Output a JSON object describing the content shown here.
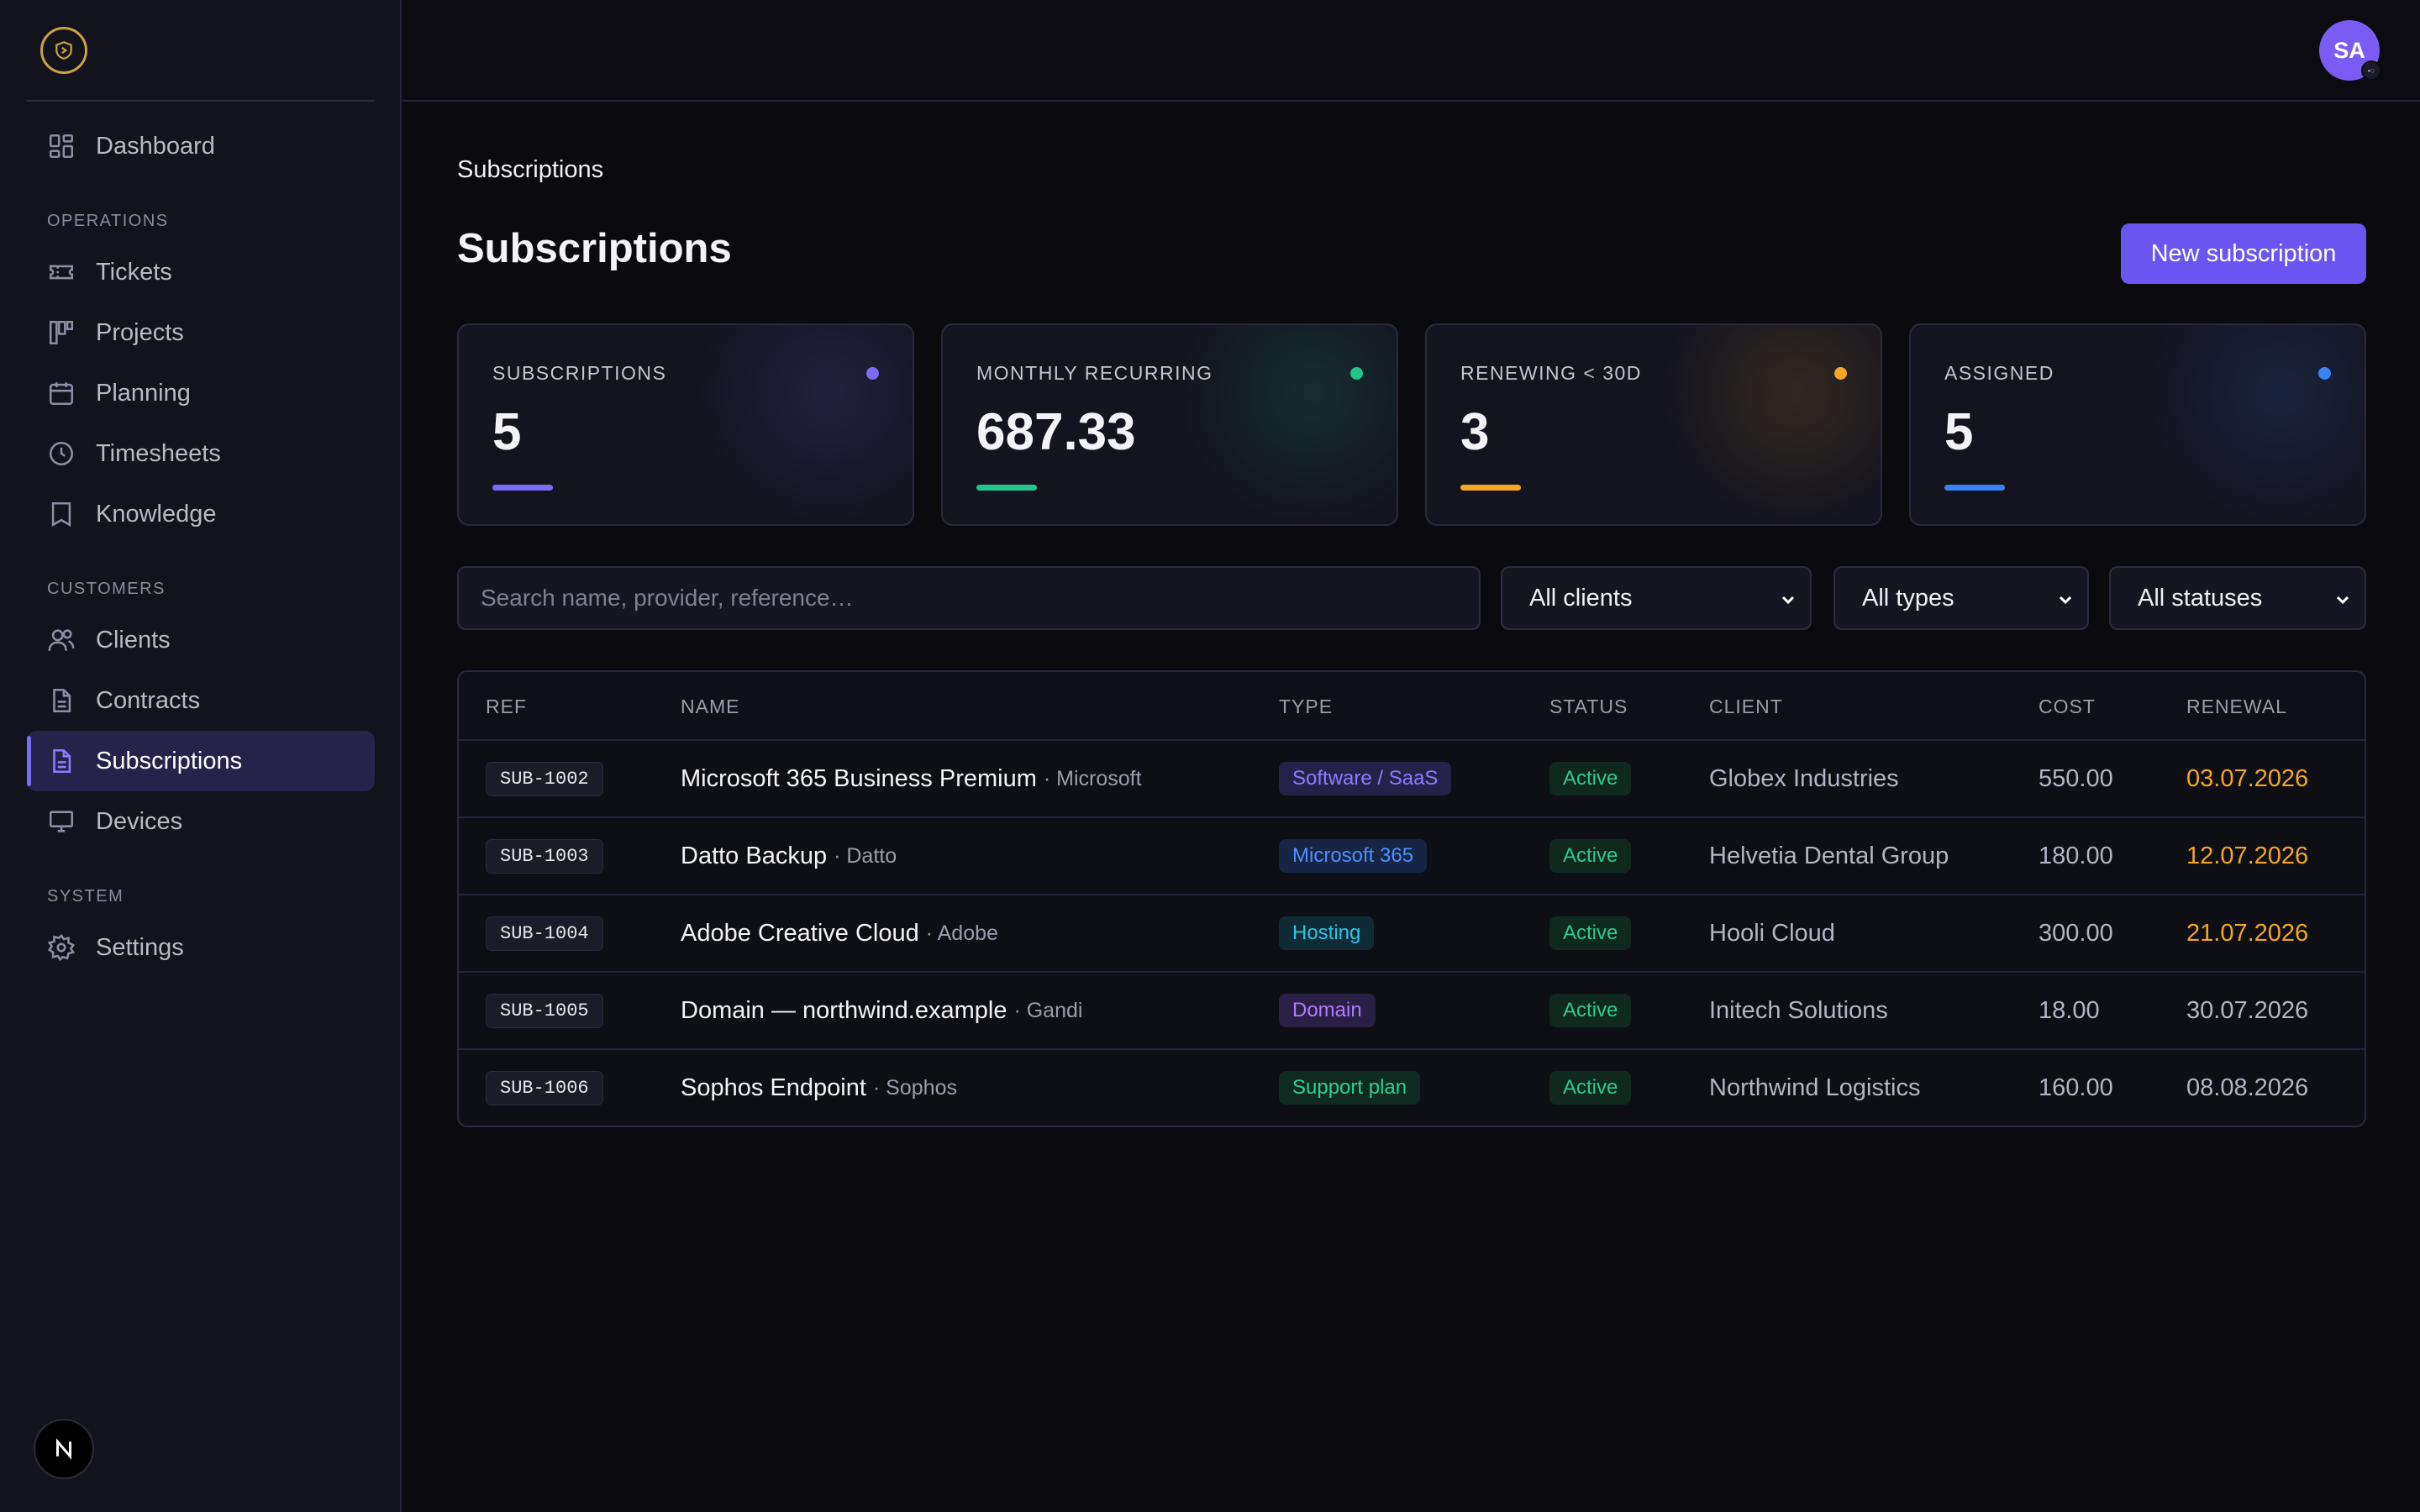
{
  "sidebar": {
    "items": [
      {
        "label": "Dashboard",
        "icon": "dashboard-icon"
      },
      {
        "section": "OPERATIONS"
      },
      {
        "label": "Tickets",
        "icon": "ticket-icon"
      },
      {
        "label": "Projects",
        "icon": "kanban-icon"
      },
      {
        "label": "Planning",
        "icon": "calendar-icon"
      },
      {
        "label": "Timesheets",
        "icon": "clock-icon"
      },
      {
        "label": "Knowledge",
        "icon": "book-icon"
      },
      {
        "section": "CUSTOMERS"
      },
      {
        "label": "Clients",
        "icon": "users-icon"
      },
      {
        "label": "Contracts",
        "icon": "document-icon"
      },
      {
        "label": "Subscriptions",
        "icon": "document-icon",
        "active": true
      },
      {
        "label": "Devices",
        "icon": "monitor-icon"
      },
      {
        "section": "SYSTEM"
      },
      {
        "label": "Settings",
        "icon": "gear-icon"
      }
    ],
    "footer_badge": "N"
  },
  "header": {
    "avatar_initials": "SA"
  },
  "main": {
    "breadcrumb": "Subscriptions",
    "title": "Subscriptions",
    "new_button": "New subscription",
    "stats": [
      {
        "label": "SUBSCRIPTIONS",
        "value": "5",
        "color": "#7b6cf6"
      },
      {
        "label": "MONTHLY RECURRING",
        "value": "687.33",
        "color": "#22c58b"
      },
      {
        "label": "RENEWING < 30D",
        "value": "3",
        "color": "#f5a623"
      },
      {
        "label": "ASSIGNED",
        "value": "5",
        "color": "#3b82f6"
      }
    ],
    "search": {
      "placeholder": "Search name, provider, reference…",
      "value": ""
    },
    "filters": {
      "clients": "All clients",
      "types": "All types",
      "statuses": "All statuses"
    },
    "table": {
      "columns": [
        "REF",
        "NAME",
        "TYPE",
        "STATUS",
        "CLIENT",
        "COST",
        "RENEWAL"
      ],
      "rows": [
        {
          "ref": "SUB-1002",
          "name": "Microsoft 365 Business Premium",
          "provider": "· Microsoft",
          "type": "Software / SaaS",
          "status": "Active",
          "client": "Globex Industries",
          "cost": "550.00",
          "renewal": "03.07.2026",
          "soon": true
        },
        {
          "ref": "SUB-1003",
          "name": "Datto Backup",
          "provider": "· Datto",
          "type": "Microsoft 365",
          "status": "Active",
          "client": "Helvetia Dental Group",
          "cost": "180.00",
          "renewal": "12.07.2026",
          "soon": true
        },
        {
          "ref": "SUB-1004",
          "name": "Adobe Creative Cloud",
          "provider": "· Adobe",
          "type": "Hosting",
          "status": "Active",
          "client": "Hooli Cloud",
          "cost": "300.00",
          "renewal": "21.07.2026",
          "soon": true
        },
        {
          "ref": "SUB-1005",
          "name": "Domain — northwind.example",
          "provider": "· Gandi",
          "type": "Domain",
          "status": "Active",
          "client": "Initech Solutions",
          "cost": "18.00",
          "renewal": "30.07.2026",
          "soon": false
        },
        {
          "ref": "SUB-1006",
          "name": "Sophos Endpoint",
          "provider": "· Sophos",
          "type": "Support plan",
          "status": "Active",
          "client": "Northwind Logistics",
          "cost": "160.00",
          "renewal": "08.08.2026",
          "soon": false
        }
      ]
    },
    "type_colors": {
      "Software / SaaS": {
        "fg": "#8b7cff",
        "bg": "#25224a"
      },
      "Microsoft 365": {
        "fg": "#4f8fff",
        "bg": "#162544"
      },
      "Hosting": {
        "fg": "#2ec4e6",
        "bg": "#0f2c36"
      },
      "Domain": {
        "fg": "#b07cff",
        "bg": "#2a1f44"
      },
      "Support plan": {
        "fg": "#2fd08c",
        "bg": "#0f2b21"
      }
    }
  }
}
